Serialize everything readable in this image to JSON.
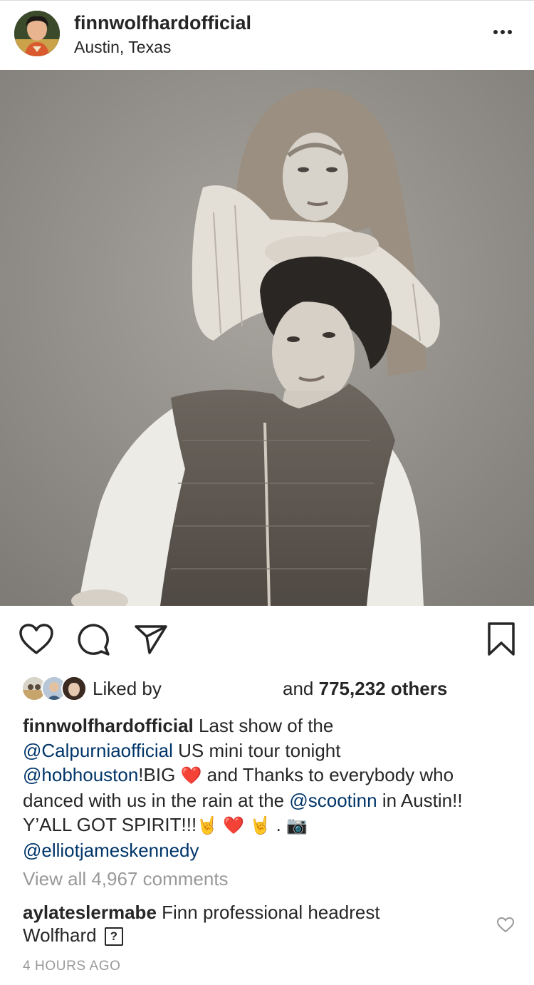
{
  "post": {
    "username": "finnwolfhardofficial",
    "location": "Austin, Texas"
  },
  "likes": {
    "liked_by_label": "Liked by",
    "and_label": "and",
    "count": "775,232 others"
  },
  "caption": {
    "username": "finnwolfhardofficial",
    "text_1": "Last show of the",
    "mention_1": "@Calpurniaofficial",
    "text_2": "US mini tour tonight",
    "mention_2": "@hobhouston",
    "text_3": "!BIG",
    "emoji_heart": "❤️",
    "text_4": "and Thanks to everybody who danced with us in the rain at the",
    "mention_3": "@scootinn",
    "text_5": "in Austin!! Y’ALL GOT SPIRIT!!!",
    "emoji_rock": "🤘",
    "text_dot": ".",
    "emoji_camera": "📷",
    "mention_4": "@elliotjameskennedy"
  },
  "comments": {
    "view_all": "View all 4,967 comments",
    "items": [
      {
        "username": "aylateslermabe",
        "text_1": "Finn professional headrest",
        "text_2": "Wolfhard",
        "glyph": "?"
      }
    ]
  },
  "timestamp": "4 HOURS AGO",
  "icons": {
    "more": "more-dots-icon",
    "like": "heart-outline-icon",
    "comment": "speech-bubble-icon",
    "share": "paper-plane-icon",
    "save": "bookmark-icon",
    "comment_like": "small-heart-icon"
  },
  "colors": {
    "text": "#262626",
    "mention": "#003569",
    "muted": "#999999",
    "heart": "#e0192b"
  }
}
